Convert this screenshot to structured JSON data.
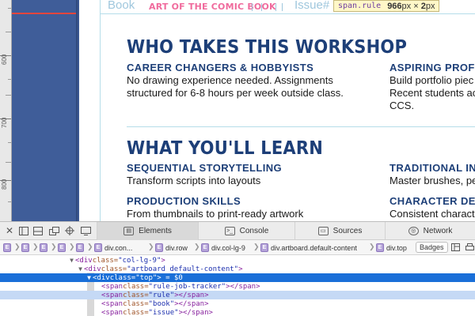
{
  "page": {
    "ruler_labels": [
      "600",
      "700",
      "800"
    ],
    "header_strip": {
      "book_label": "Book",
      "comic_label": "ART OF THE COMIC BOOK",
      "issue_label": "Issue#"
    },
    "tooltip": {
      "selector": "span.rule",
      "width": "966",
      "height": "2",
      "unit": "px",
      "times": "×"
    },
    "section1": {
      "heading": "WHO TAKES THIS WORKSHOP",
      "col1_title": "CAREER CHANGERS & HOBBYISTS",
      "col1_line1": "No drawing experience needed. Assignments",
      "col1_line2": "structured for 6-8 hours per week outside class.",
      "col2_title": "ASPIRING PROFE",
      "col2_line1": "Build portfolio piec",
      "col2_line2": "Recent students ac",
      "col2_line3": "CCS."
    },
    "section2": {
      "heading": "WHAT YOU'LL LEARN",
      "item1_title": "SEQUENTIAL STORYTELLING",
      "item1_text": "Transform scripts into layouts",
      "item2_title": "PRODUCTION SKILLS",
      "item2_text": "From thumbnails to print-ready artwork",
      "item3_title": "TRADITIONAL INI",
      "item3_text": "Master brushes, pe",
      "item4_title": "CHARACTER DES",
      "item4_text": "Consistent charact"
    },
    "colors": {
      "navy": "#1d3f78",
      "sidebar_blue": "#3f5d99",
      "pink": "#f06b9d",
      "guide": "#b5dde9"
    }
  },
  "devtools": {
    "tabs": [
      {
        "label": "Elements",
        "icon": "elements-icon",
        "active": true
      },
      {
        "label": "Console",
        "icon": "console-icon",
        "active": false
      },
      {
        "label": "Sources",
        "icon": "sources-icon",
        "active": false
      },
      {
        "label": "Network",
        "icon": "network-icon",
        "active": false
      }
    ],
    "breadcrumbs": [
      "div.con...",
      "div.row",
      "div.col-lg-9",
      "div.artboard.default-content",
      "div.top"
    ],
    "badges_label": "Badges",
    "dom": [
      {
        "open": "<",
        "tag": "div",
        "attr": " class=",
        "val": "\"col-lg-9\"",
        "close": ">"
      },
      {
        "open": "<",
        "tag": "div",
        "attr": " class=",
        "val": "\"artboard default-content\"",
        "close": ">"
      },
      {
        "open": "<",
        "tag": "div",
        "attr": " class=",
        "val": "\"top\"",
        "close": "> = $0"
      },
      {
        "open": "<",
        "tag": "span",
        "attr": " class=",
        "val": "\"rule-job-tracker\"",
        "close": "></span>"
      },
      {
        "open": "<",
        "tag": "span",
        "attr": " class=",
        "val": "\"rule\"",
        "close": "></span>"
      },
      {
        "open": "<",
        "tag": "span",
        "attr": " class=",
        "val": "\"book\"",
        "close": "></span>"
      },
      {
        "open": "<",
        "tag": "span",
        "attr": " class=",
        "val": "\"issue\"",
        "close": "></span>"
      }
    ]
  }
}
